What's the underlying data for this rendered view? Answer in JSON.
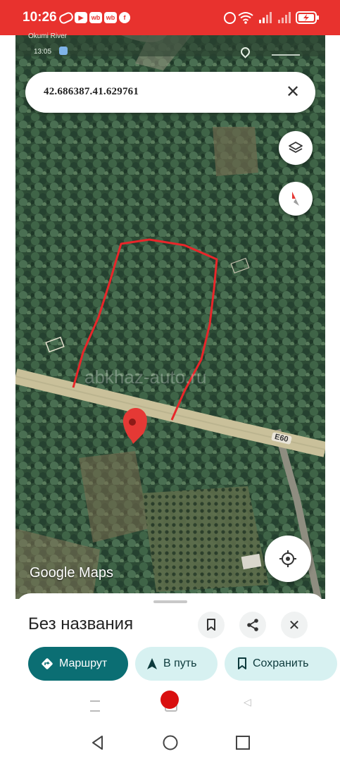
{
  "status_bar": {
    "time": "10:26",
    "notification_icons": [
      "link-icon",
      "youtube-icon",
      "wb-icon",
      "wb-icon",
      "facebook-icon"
    ],
    "system_icons": [
      "alarm-icon",
      "wifi-icon",
      "signal-icon",
      "signal-icon",
      "battery-charging-icon"
    ],
    "accent_color": "#e8322e"
  },
  "inner_status": {
    "time": "13:05",
    "location_label": "Okumi River"
  },
  "search": {
    "value": "42.686387.41.629761"
  },
  "map": {
    "road_label": "E60",
    "watermark": "abkhaz-auto.ru",
    "attribution": "Google Maps",
    "pin_color": "#e53935",
    "outline_color": "#e8262a"
  },
  "sheet": {
    "title": "Без названия",
    "actions": {
      "route": "Маршрут",
      "start": "В путь",
      "save": "Сохранить"
    },
    "route_color": "#0b6e73",
    "secondary_color": "#d7f1f1"
  }
}
